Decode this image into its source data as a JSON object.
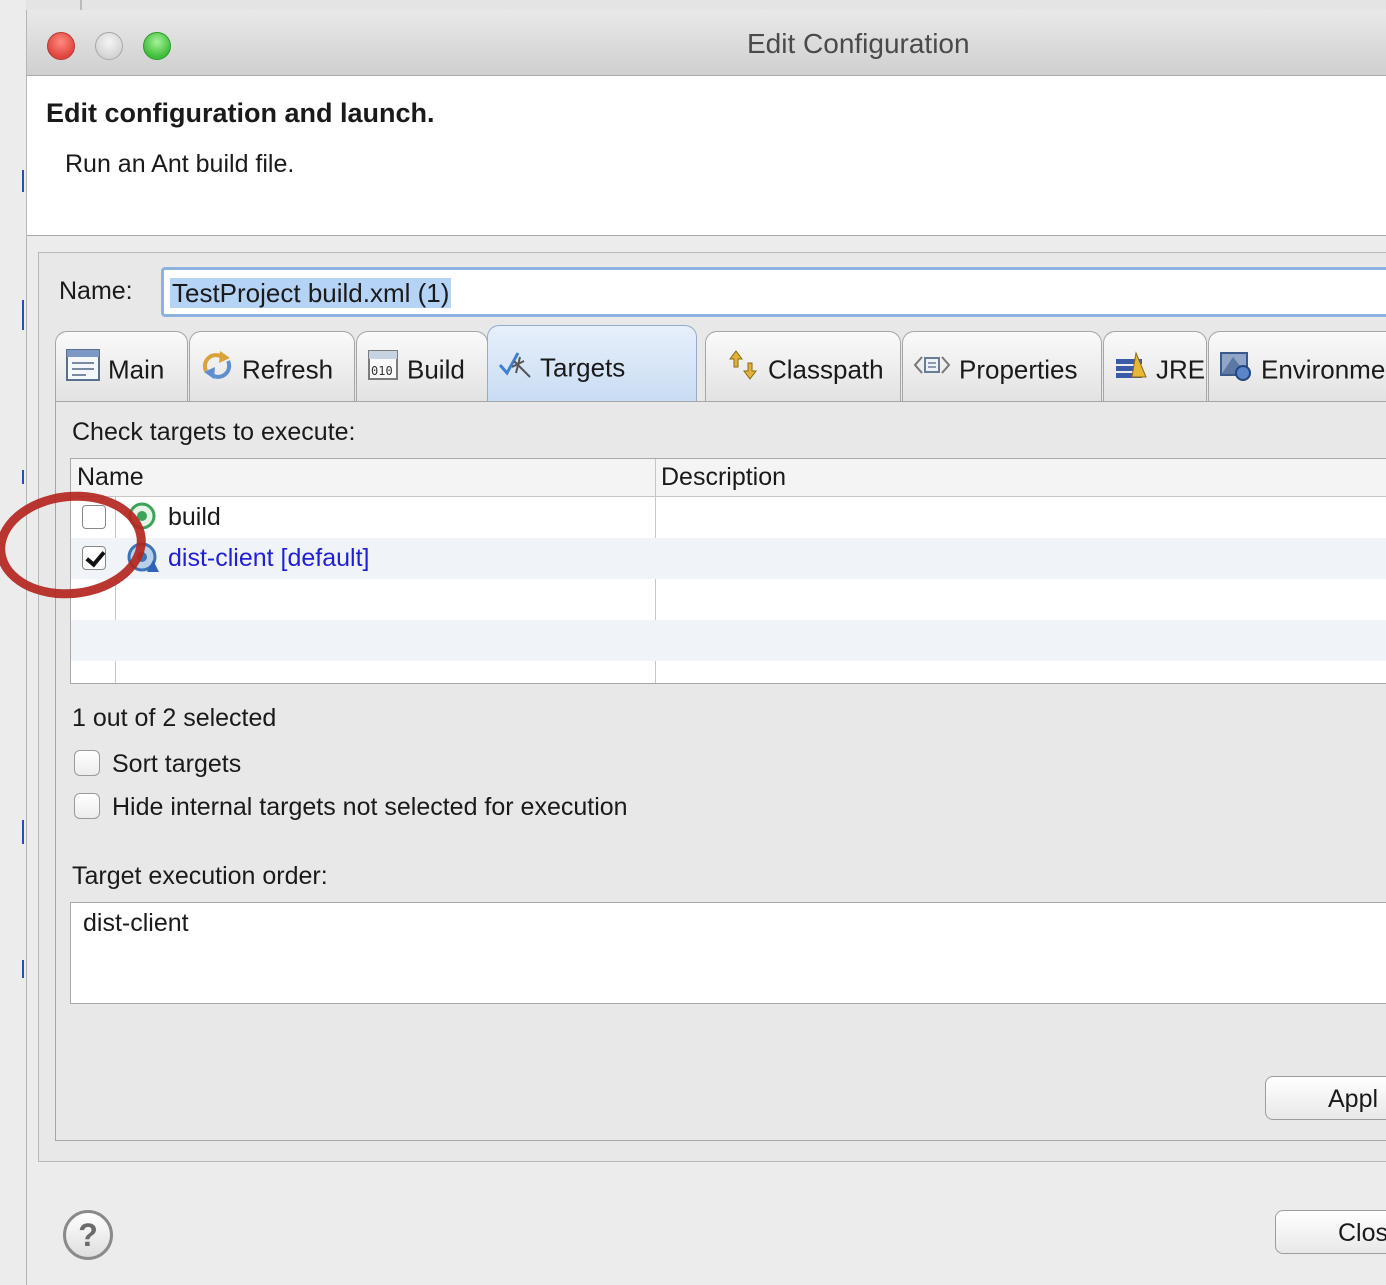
{
  "window": {
    "title": "Edit Configuration"
  },
  "banner": {
    "title": "Edit configuration and launch.",
    "subtitle": "Run an Ant build file."
  },
  "name_field": {
    "label": "Name:",
    "value": "TestProject build.xml (1)"
  },
  "tabs": [
    {
      "label": "Main",
      "icon": "main-tab-icon",
      "active": false
    },
    {
      "label": "Refresh",
      "icon": "refresh-icon",
      "active": false
    },
    {
      "label": "Build",
      "icon": "build-binary-icon",
      "active": false
    },
    {
      "label": "Targets",
      "icon": "targets-icon",
      "active": true
    },
    {
      "label": "Classpath",
      "icon": "classpath-icon",
      "active": false
    },
    {
      "label": "Properties",
      "icon": "properties-icon",
      "active": false
    },
    {
      "label": "JRE",
      "icon": "jre-icon",
      "active": false
    },
    {
      "label": "Environme",
      "icon": "environment-icon",
      "active": false
    }
  ],
  "targets": {
    "instruction": "Check targets to execute:",
    "columns": [
      "Name",
      "Description"
    ],
    "rows": [
      {
        "name": "build",
        "description": "",
        "checked": false,
        "default": false,
        "icon": "ant-target-icon"
      },
      {
        "name": "dist-client [default]",
        "description": "",
        "checked": true,
        "default": true,
        "icon": "ant-default-target-icon"
      }
    ],
    "selection_status": "1 out of 2 selected"
  },
  "options": {
    "sort_targets": "Sort targets",
    "hide_internal": "Hide internal targets not selected for execution"
  },
  "execution_order": {
    "label": "Target execution order:",
    "value": "dist-client"
  },
  "buttons": {
    "apply": "Appl",
    "close": "Clos"
  },
  "help": {
    "glyph": "?"
  },
  "colors": {
    "default_target_text": "#1f1fd6",
    "annotation_ring": "#b3261e",
    "active_tab": "#c9dcf3"
  }
}
